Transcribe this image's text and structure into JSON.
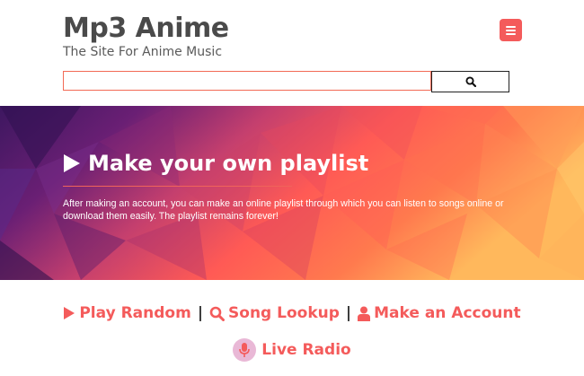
{
  "header": {
    "site_title": "Mp3 Anime",
    "tagline": "The Site For Anime Music",
    "menu_icon": "hamburger-menu-icon",
    "search_placeholder": "",
    "search_icon": "search-icon"
  },
  "hero": {
    "title": "Make your own playlist",
    "title_icon": "play-icon",
    "description": "After making an account, you can make an online playlist through which you can listen to songs online or download them easily. The playlist remains forever!"
  },
  "nav": {
    "links": [
      {
        "label": "Play Random",
        "icon": "play-icon"
      },
      {
        "label": "Song Lookup",
        "icon": "search-icon"
      },
      {
        "label": "Make an Account",
        "icon": "user-icon"
      }
    ],
    "separator": "|",
    "radio": {
      "label": "Live Radio",
      "icon": "microphone-icon"
    }
  },
  "colors": {
    "accent": "#f45b5b",
    "title_text": "#4a4a4a",
    "hero_purple": "#4b1a6e",
    "hero_orange": "#ff8a4a"
  }
}
